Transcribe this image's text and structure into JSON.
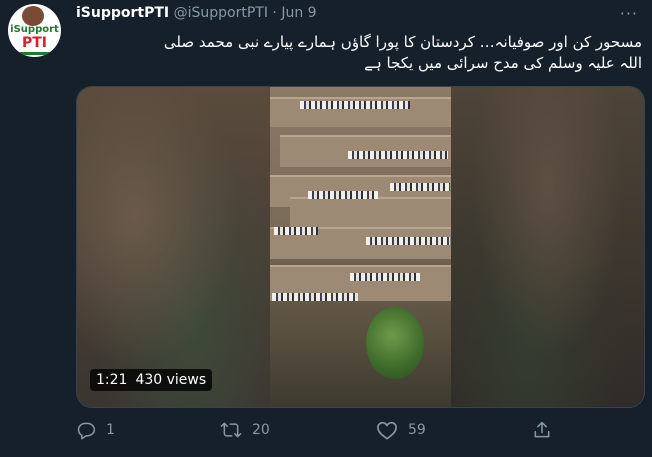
{
  "tweet": {
    "display_name": "iSupportPTI",
    "handle": "@iSupportPTI",
    "separator": "·",
    "date": "Jun 9",
    "text_line1": "مسحور کن اور صوفیانہ… کردستان کا پورا گاؤں ہمارے پیارے نبی محمد صلی",
    "text_line2": "اللہ علیہ وسلم کی مدح سرائی میں یکجا ہے",
    "more_glyph": "···"
  },
  "avatar": {
    "line1": "iSupport",
    "line2": "PTI"
  },
  "video": {
    "duration": "1:21",
    "views": "430 views"
  },
  "actions": {
    "reply_count": "1",
    "retweet_count": "20",
    "like_count": "59"
  },
  "colors": {
    "background": "#15202b",
    "secondary_text": "#8899a6",
    "border": "#38444d"
  }
}
